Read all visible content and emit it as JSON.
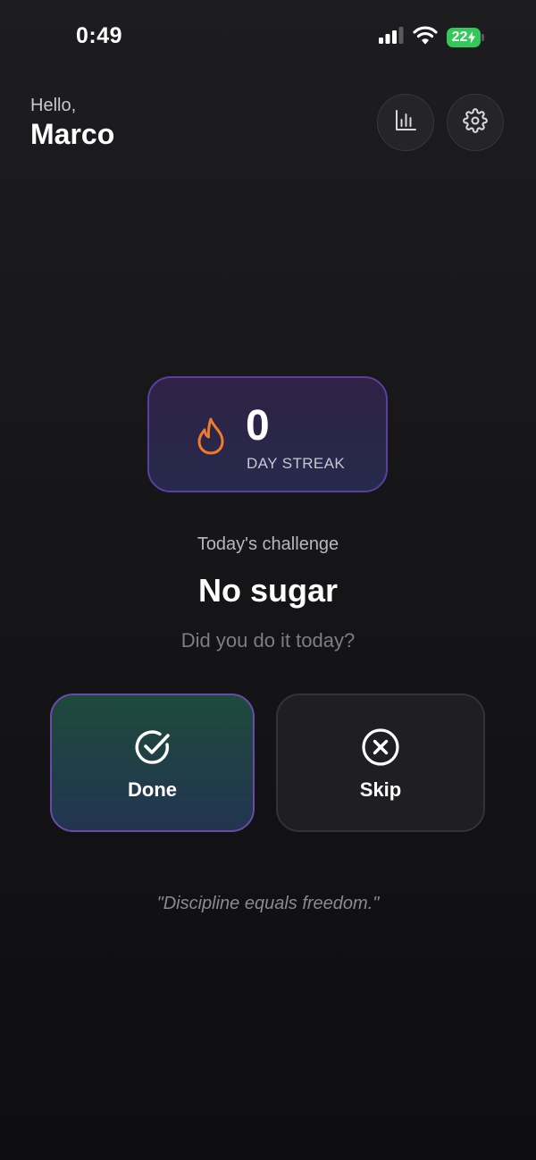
{
  "status_bar": {
    "time": "0:49",
    "battery_level": "22",
    "icons": [
      "cellular-signal-icon",
      "wifi-icon",
      "battery-charging-icon"
    ]
  },
  "header": {
    "greeting": "Hello,",
    "user_name": "Marco",
    "buttons": [
      "bar-chart-icon",
      "gear-icon"
    ]
  },
  "streak": {
    "count": "0",
    "label": "DAY STREAK",
    "icon": "flame-icon"
  },
  "challenge": {
    "caption": "Today's challenge",
    "title": "No sugar",
    "question": "Did you do it today?"
  },
  "actions": {
    "done_label": "Done",
    "done_icon": "check-circle-icon",
    "skip_label": "Skip",
    "skip_icon": "x-circle-icon"
  },
  "quote": "\"Discipline equals freedom.\"",
  "colors": {
    "background": "#161618",
    "accent_purple": "#5a3f9e",
    "flame_orange": "#f07a2c",
    "done_green": "#1e4a3c",
    "battery_green": "#34c759"
  }
}
